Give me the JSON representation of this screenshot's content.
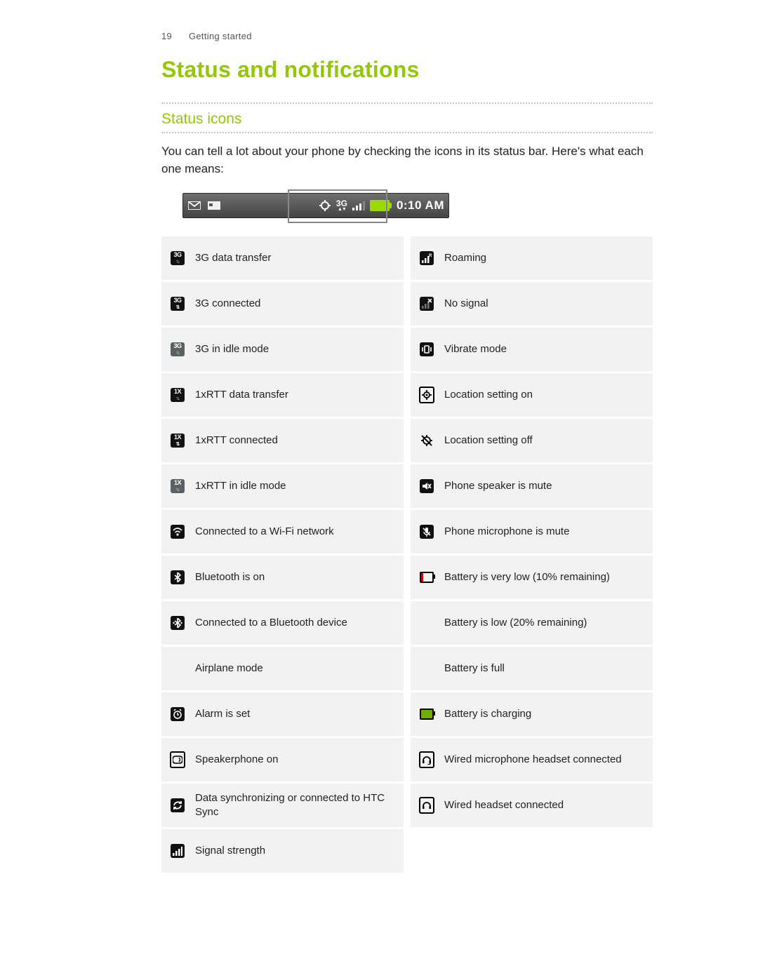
{
  "header": {
    "page_number": "19",
    "section": "Getting started"
  },
  "title": "Status and notifications",
  "section_title": "Status icons",
  "intro": "You can tell a lot about your phone by checking the icons in its status bar. Here's what each one means:",
  "statusbar": {
    "time": "0:10 AM",
    "net_label": "3G"
  },
  "left_items": [
    {
      "icon": "3g-transfer-icon",
      "label": "3G data transfer"
    },
    {
      "icon": "3g-connected-icon",
      "label": "3G connected"
    },
    {
      "icon": "3g-idle-icon",
      "label": "3G in idle mode"
    },
    {
      "icon": "1x-transfer-icon",
      "label": "1xRTT data transfer"
    },
    {
      "icon": "1x-connected-icon",
      "label": "1xRTT connected"
    },
    {
      "icon": "1x-idle-icon",
      "label": "1xRTT in idle mode"
    },
    {
      "icon": "wifi-icon",
      "label": "Connected to a Wi-Fi network"
    },
    {
      "icon": "bluetooth-icon",
      "label": "Bluetooth is on"
    },
    {
      "icon": "bluetooth-connected-icon",
      "label": "Connected to a Bluetooth device"
    },
    {
      "icon": "airplane-icon",
      "label": "Airplane mode"
    },
    {
      "icon": "alarm-icon",
      "label": "Alarm is set"
    },
    {
      "icon": "speakerphone-icon",
      "label": "Speakerphone on"
    },
    {
      "icon": "sync-icon",
      "label": "Data synchronizing or connected to HTC Sync"
    },
    {
      "icon": "signal-icon",
      "label": "Signal strength"
    }
  ],
  "right_items": [
    {
      "icon": "roaming-icon",
      "label": "Roaming"
    },
    {
      "icon": "no-signal-icon",
      "label": "No signal"
    },
    {
      "icon": "vibrate-icon",
      "label": "Vibrate mode"
    },
    {
      "icon": "location-on-icon",
      "label": "Location setting on"
    },
    {
      "icon": "location-off-icon",
      "label": "Location setting off"
    },
    {
      "icon": "speaker-mute-icon",
      "label": "Phone speaker is mute"
    },
    {
      "icon": "mic-mute-icon",
      "label": "Phone microphone is mute"
    },
    {
      "icon": "battery-very-low-icon",
      "label": "Battery is very low (10% remaining)"
    },
    {
      "icon": "battery-low-icon",
      "label": "Battery is low (20% remaining)"
    },
    {
      "icon": "battery-full-icon",
      "label": "Battery is full"
    },
    {
      "icon": "battery-charging-icon",
      "label": "Battery is charging"
    },
    {
      "icon": "wired-mic-headset-icon",
      "label": "Wired microphone headset connected"
    },
    {
      "icon": "wired-headset-icon",
      "label": "Wired headset connected"
    }
  ]
}
